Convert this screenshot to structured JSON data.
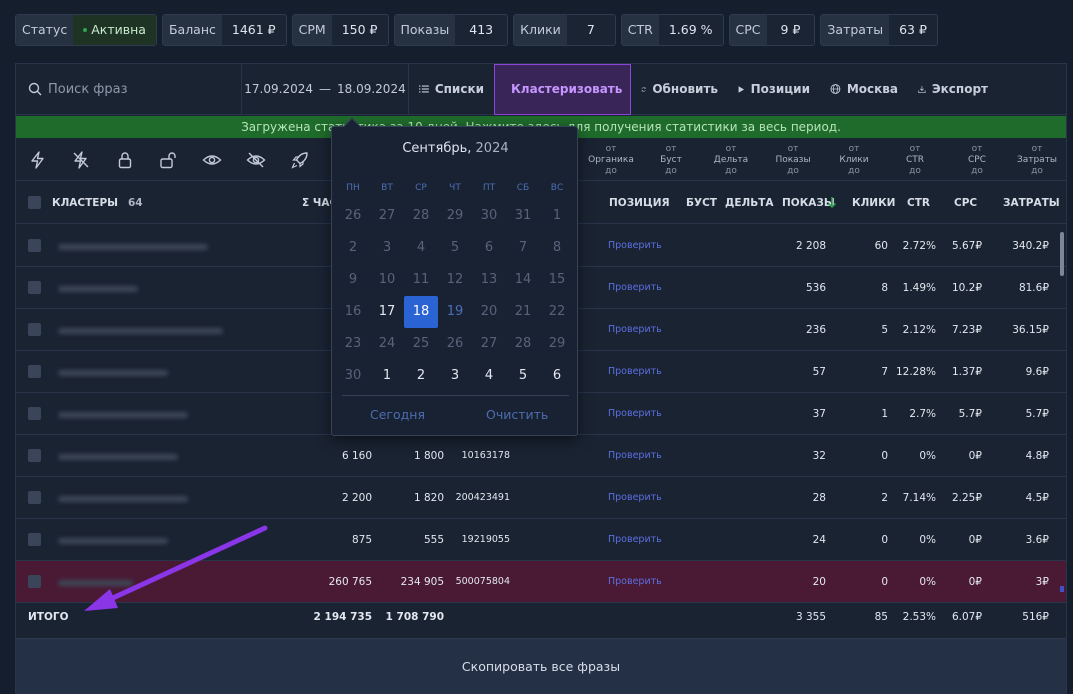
{
  "stats": [
    {
      "label": "Статус",
      "value": "Активна"
    },
    {
      "label": "Баланс",
      "value": "1461 ₽"
    },
    {
      "label": "CPM",
      "value": "150 ₽"
    },
    {
      "label": "Показы",
      "value": "413"
    },
    {
      "label": "Клики",
      "value": "7"
    },
    {
      "label": "CTR",
      "value": "1.69 %"
    },
    {
      "label": "CPC",
      "value": "9 ₽"
    },
    {
      "label": "Затраты",
      "value": "63 ₽"
    }
  ],
  "toolbar": {
    "search_placeholder": "Поиск фраз",
    "date_from": "17.09.2024",
    "date_dash": "—",
    "date_to": "18.09.2024",
    "lists": "Списки",
    "cluster": "Кластеризовать",
    "refresh": "Обновить",
    "positions": "Позиции",
    "region": "Москва",
    "export": "Экспорт"
  },
  "notice": "Загружена статистика за 10 дней. Нажмите здесь для получения статистики за весь период.",
  "filters": {
    "organic": [
      "от",
      "Органика",
      "до"
    ],
    "boost": [
      "от",
      "Буст",
      "до"
    ],
    "delta": [
      "от",
      "Дельта",
      "до"
    ],
    "shows": [
      "от",
      "Показы",
      "до"
    ],
    "clicks": [
      "от",
      "Клики",
      "до"
    ],
    "ctr": [
      "от",
      "CTR",
      "до"
    ],
    "cpc": [
      "от",
      "CPC",
      "до"
    ],
    "costs": [
      "от",
      "Затраты",
      "до"
    ]
  },
  "header": {
    "clusters": "КЛАСТЕРЫ",
    "clusters_count": "64",
    "sum_freq": "Σ ЧАС",
    "position": "ПОЗИЦИЯ",
    "boost": "БУСТ",
    "delta": "ДЕЛЬТА",
    "shows": "ПОКАЗЫ",
    "clicks": "КЛИКИ",
    "ctr": "CTR",
    "cpc": "CPC",
    "costs": "ЗАТРАТЫ"
  },
  "rows": [
    {
      "f1": "",
      "f2": "",
      "f3": "",
      "pos": "Проверить",
      "shows": "2 208",
      "clicks": "60",
      "ctr": "2.72%",
      "cpc": "5.67₽",
      "costs": "340.2₽"
    },
    {
      "f1": "",
      "f2": "",
      "f3": "",
      "pos": "Проверить",
      "shows": "536",
      "clicks": "8",
      "ctr": "1.49%",
      "cpc": "10.2₽",
      "costs": "81.6₽"
    },
    {
      "f1": "",
      "f2": "",
      "f3": "",
      "pos": "Проверить",
      "shows": "236",
      "clicks": "5",
      "ctr": "2.12%",
      "cpc": "7.23₽",
      "costs": "36.15₽"
    },
    {
      "f1": "",
      "f2": "",
      "f3": "",
      "pos": "Проверить",
      "shows": "57",
      "clicks": "7",
      "ctr": "12.28%",
      "cpc": "1.37₽",
      "costs": "9.6₽"
    },
    {
      "f1": "",
      "f2": "",
      "f3": "",
      "pos": "Проверить",
      "shows": "37",
      "clicks": "1",
      "ctr": "2.7%",
      "cpc": "5.7₽",
      "costs": "5.7₽"
    },
    {
      "f1": "6 160",
      "f2": "1 800",
      "f3": "10163178",
      "pos": "Проверить",
      "shows": "32",
      "clicks": "0",
      "ctr": "0%",
      "cpc": "0₽",
      "costs": "4.8₽"
    },
    {
      "f1": "2 200",
      "f2": "1 820",
      "f3": "200423491",
      "pos": "Проверить",
      "shows": "28",
      "clicks": "2",
      "ctr": "7.14%",
      "cpc": "2.25₽",
      "costs": "4.5₽"
    },
    {
      "f1": "875",
      "f2": "555",
      "f3": "19219055",
      "pos": "Проверить",
      "shows": "24",
      "clicks": "0",
      "ctr": "0%",
      "cpc": "0₽",
      "costs": "3.6₽"
    },
    {
      "f1": "260 765",
      "f2": "234 905",
      "f3": "500075804",
      "pos": "Проверить",
      "shows": "20",
      "clicks": "0",
      "ctr": "0%",
      "cpc": "0₽",
      "costs": "3₽"
    }
  ],
  "total": {
    "label": "ИТОГО",
    "f1": "2 194 735",
    "f2": "1 708 790",
    "shows": "3 355",
    "clicks": "85",
    "ctr": "2.53%",
    "cpc": "6.07₽",
    "costs": "516₽"
  },
  "copy_all": "Скопировать все фразы",
  "calendar": {
    "month": "Сентябрь,",
    "year": "2024",
    "weekdays": [
      "ПН",
      "ВТ",
      "СР",
      "ЧТ",
      "ПТ",
      "СБ",
      "ВС"
    ],
    "weeks": [
      [
        "26",
        "27",
        "28",
        "29",
        "30",
        "31",
        "1"
      ],
      [
        "2",
        "3",
        "4",
        "5",
        "6",
        "7",
        "8"
      ],
      [
        "9",
        "10",
        "11",
        "12",
        "13",
        "14",
        "15"
      ],
      [
        "16",
        "17",
        "18",
        "19",
        "20",
        "21",
        "22"
      ],
      [
        "23",
        "24",
        "25",
        "26",
        "27",
        "28",
        "29"
      ],
      [
        "30",
        "1",
        "2",
        "3",
        "4",
        "5",
        "6"
      ]
    ],
    "selected": "18",
    "today": "Сегодня",
    "clear": "Очистить"
  },
  "colors": {
    "accent_purple": "#8a46d6",
    "notice_green": "#1f6b2b",
    "selected_blue": "#2a64d4",
    "highlight_row": "#4a1a34",
    "link": "#5b6fe0"
  }
}
